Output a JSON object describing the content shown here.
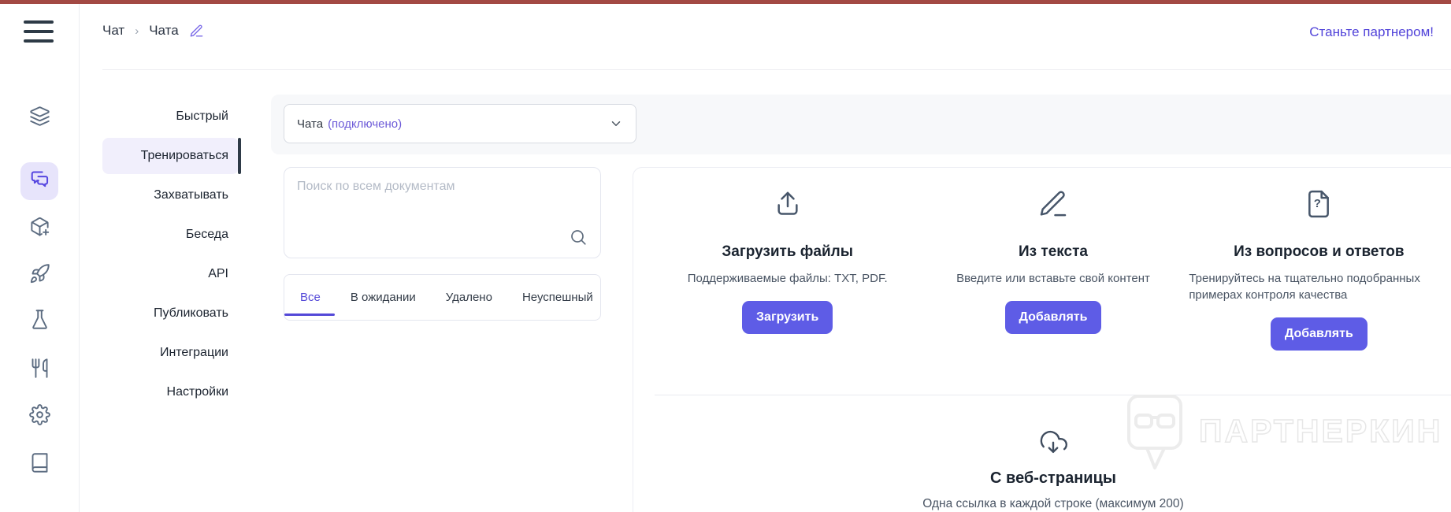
{
  "header": {
    "breadcrumb": {
      "root": "Чат",
      "separator": "›",
      "current": "Чата",
      "edit_icon": "pencil-icon"
    },
    "partner_link": "Станьте партнером!"
  },
  "sidebar": {
    "icons": [
      {
        "name": "layers-icon",
        "active": false
      },
      {
        "name": "chat-bubbles-icon",
        "active": true
      },
      {
        "name": "box-add-icon",
        "active": false
      },
      {
        "name": "rocket-icon",
        "active": false
      },
      {
        "name": "flask-icon",
        "active": false
      },
      {
        "name": "utensils-icon",
        "active": false
      },
      {
        "name": "gear-icon",
        "active": false
      },
      {
        "name": "book-icon",
        "active": false
      }
    ]
  },
  "nav": {
    "items": [
      {
        "label": "Быстрый",
        "active": false
      },
      {
        "label": "Тренироваться",
        "active": true
      },
      {
        "label": "Захватывать",
        "active": false
      },
      {
        "label": "Беседа",
        "active": false
      },
      {
        "label": "API",
        "active": false
      },
      {
        "label": "Публиковать",
        "active": false
      },
      {
        "label": "Интеграции",
        "active": false
      },
      {
        "label": "Настройки",
        "active": false
      }
    ]
  },
  "toolbar": {
    "select": {
      "value": "Чата",
      "status": "(подключено)",
      "chevron_icon": "chevron-down-icon"
    }
  },
  "search": {
    "placeholder": "Поиск по всем документам",
    "icon": "search-icon"
  },
  "tabs": {
    "items": [
      {
        "label": "Все",
        "active": true
      },
      {
        "label": "В ожидании",
        "active": false
      },
      {
        "label": "Удалено",
        "active": false
      },
      {
        "label": "Неуспешный",
        "active": false
      }
    ]
  },
  "sources": {
    "cards": [
      {
        "icon": "upload-icon",
        "title": "Загрузить файлы",
        "subtitle": "Поддерживаемые файлы: TXT, PDF.",
        "button": "Загрузить"
      },
      {
        "icon": "pencil-icon",
        "title": "Из текста",
        "subtitle": "Введите или вставьте свой контент",
        "button": "Добавлять"
      },
      {
        "icon": "question-document-icon",
        "title": "Из вопросов и ответов",
        "subtitle": "Тренируйтесь на тщательно подобранных примерах контроля качества",
        "button": "Добавлять"
      }
    ],
    "web": {
      "icon": "cloud-download-icon",
      "title": "С веб-страницы",
      "subtitle": "Одна ссылка в каждой строке (максимум 200)"
    }
  },
  "watermark": {
    "text": "ПАРТНЕРКИН",
    "logo": "partnerkin-bubble-logo"
  },
  "colors": {
    "topbar": "#a34944",
    "accent": "#5143d9",
    "button": "#5e5ce6",
    "active_nav_bg": "#f1effc",
    "active_nav_indicator": "#2e3a47",
    "active_icon_bg": "#e7e4fb",
    "gray_band": "#f7f8fa"
  }
}
